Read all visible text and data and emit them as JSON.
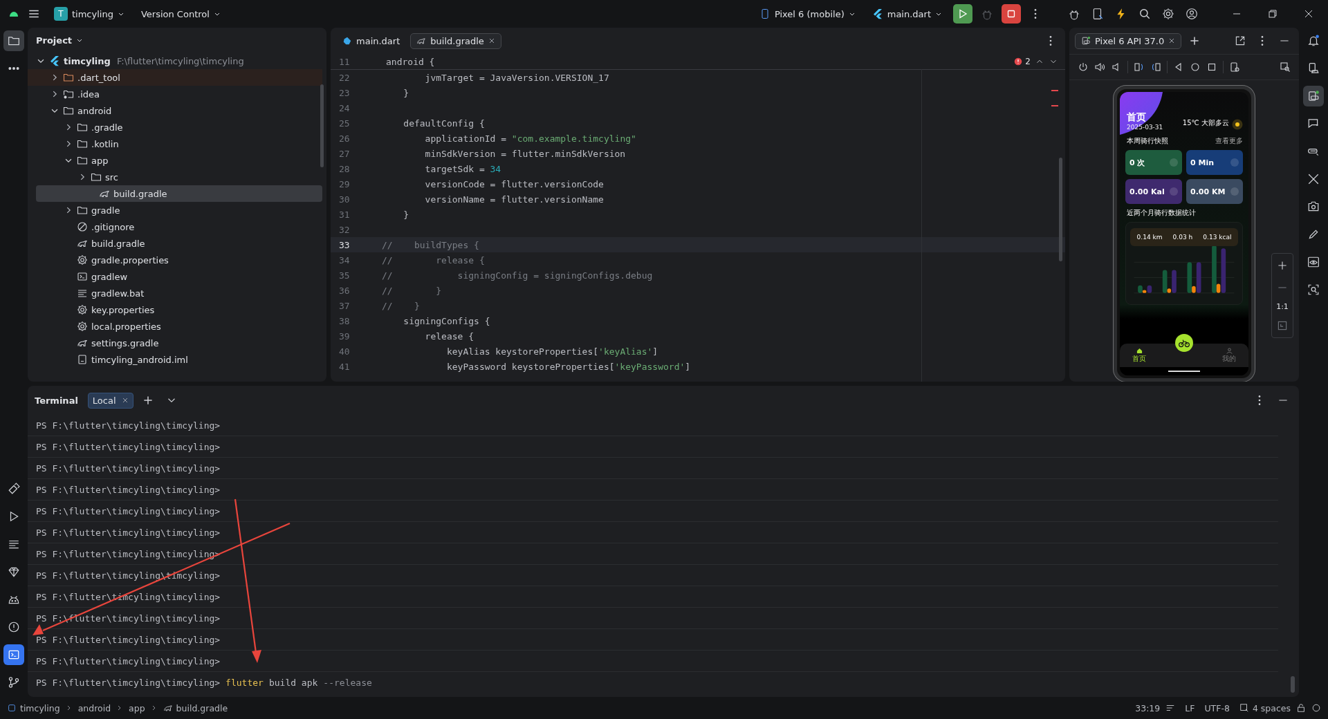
{
  "top_bar": {
    "project_badge": "T",
    "project": "timcyling",
    "vcs": "Version Control",
    "device": "Pixel 6 (mobile)",
    "run_config": "main.dart"
  },
  "left_tools": [
    {
      "kind": "folder",
      "selected": true
    },
    {
      "kind": "more",
      "selected": false
    }
  ],
  "left_tools_bottom": [
    {
      "kind": "brush",
      "selected": false
    },
    {
      "kind": "run",
      "selected": false
    },
    {
      "kind": "lines",
      "selected": false
    },
    {
      "kind": "gem",
      "selected": false
    },
    {
      "kind": "android",
      "selected": false
    },
    {
      "kind": "problems",
      "selected": false
    },
    {
      "kind": "terminal",
      "selected": true
    },
    {
      "kind": "git",
      "selected": false
    }
  ],
  "project": {
    "title": "Project",
    "tree": [
      {
        "label": "timcyling",
        "path": "F:\\flutter\\timcyling\\timcyling",
        "kind": "flutter",
        "expanded": true,
        "selected": false,
        "excluded": false,
        "children": [
          {
            "label": ".dart_tool",
            "kind": "folder",
            "expanded": false,
            "selected": false,
            "excluded": true
          },
          {
            "label": ".idea",
            "kind": "folder-config",
            "expanded": false,
            "selected": false,
            "excluded": false
          },
          {
            "label": "android",
            "kind": "folder",
            "expanded": true,
            "selected": false,
            "excluded": false,
            "children": [
              {
                "label": ".gradle",
                "kind": "folder",
                "expanded": false,
                "selected": false,
                "excluded": false
              },
              {
                "label": ".kotlin",
                "kind": "folder",
                "expanded": false,
                "selected": false,
                "excluded": false
              },
              {
                "label": "app",
                "kind": "folder",
                "expanded": true,
                "selected": false,
                "excluded": false,
                "children": [
                  {
                    "label": "src",
                    "kind": "folder",
                    "expanded": false,
                    "selected": false,
                    "excluded": false
                  },
                  {
                    "label": "build.gradle",
                    "kind": "gradle",
                    "selected": true,
                    "excluded": false
                  }
                ]
              },
              {
                "label": "gradle",
                "kind": "folder",
                "expanded": false,
                "selected": false,
                "excluded": false
              },
              {
                "label": ".gitignore",
                "kind": "ignore",
                "selected": false,
                "excluded": false
              },
              {
                "label": "build.gradle",
                "kind": "gradle",
                "selected": false,
                "excluded": false
              },
              {
                "label": "gradle.properties",
                "kind": "gear",
                "selected": false,
                "excluded": false
              },
              {
                "label": "gradlew",
                "kind": "terminal",
                "selected": false,
                "excluded": false
              },
              {
                "label": "gradlew.bat",
                "kind": "lines",
                "selected": false,
                "excluded": false
              },
              {
                "label": "key.properties",
                "kind": "gear",
                "selected": false,
                "excluded": false
              },
              {
                "label": "local.properties",
                "kind": "gear",
                "selected": false,
                "excluded": false
              },
              {
                "label": "settings.gradle",
                "kind": "gradle",
                "selected": false,
                "excluded": false
              },
              {
                "label": "timcyling_android.iml",
                "kind": "file",
                "selected": false,
                "excluded": false
              }
            ]
          }
        ]
      }
    ]
  },
  "editor": {
    "tabs": [
      {
        "label": "main.dart",
        "kind": "dart",
        "selected": false
      },
      {
        "label": "build.gradle",
        "kind": "gradle",
        "selected": true
      }
    ],
    "error_count": "2",
    "sticky": {
      "num": "11",
      "tokens": [
        {
          "kind": "plain",
          "text": "android {"
        }
      ]
    },
    "lines": [
      {
        "num": "22",
        "current": false,
        "tokens": [
          {
            "kind": "plain",
            "text": "        jvmTarget = JavaVersion.VERSION_17"
          }
        ]
      },
      {
        "num": "23",
        "current": false,
        "tokens": [
          {
            "kind": "plain",
            "text": "    }"
          }
        ]
      },
      {
        "num": "24",
        "current": false
      },
      {
        "num": "25",
        "current": false,
        "tokens": [
          {
            "kind": "plain",
            "text": "    defaultConfig {"
          }
        ]
      },
      {
        "num": "26",
        "current": false,
        "tokens": [
          {
            "kind": "plain",
            "text": "        applicationId = "
          },
          {
            "kind": "string",
            "text": "\"com.example.timcyling\""
          }
        ]
      },
      {
        "num": "27",
        "current": false,
        "tokens": [
          {
            "kind": "plain",
            "text": "        minSdkVersion = flutter.minSdkVersion"
          }
        ]
      },
      {
        "num": "28",
        "current": false,
        "tokens": [
          {
            "kind": "plain",
            "text": "        targetSdk = "
          },
          {
            "kind": "number",
            "text": "34"
          }
        ]
      },
      {
        "num": "29",
        "current": false,
        "tokens": [
          {
            "kind": "plain",
            "text": "        versionCode = flutter.versionCode"
          }
        ]
      },
      {
        "num": "30",
        "current": false,
        "tokens": [
          {
            "kind": "plain",
            "text": "        versionName = flutter.versionName"
          }
        ]
      },
      {
        "num": "31",
        "current": false,
        "tokens": [
          {
            "kind": "plain",
            "text": "    }"
          }
        ]
      },
      {
        "num": "32",
        "current": false
      },
      {
        "num": "33",
        "current": true,
        "tokens": [
          {
            "kind": "comment",
            "text": "//    buildTypes {"
          }
        ]
      },
      {
        "num": "34",
        "current": false,
        "tokens": [
          {
            "kind": "comment",
            "text": "//        release {"
          }
        ]
      },
      {
        "num": "35",
        "current": false,
        "tokens": [
          {
            "kind": "comment",
            "text": "//            signingConfig = signingConfigs.debug"
          }
        ]
      },
      {
        "num": "36",
        "current": false,
        "tokens": [
          {
            "kind": "comment",
            "text": "//        }"
          }
        ]
      },
      {
        "num": "37",
        "current": false,
        "tokens": [
          {
            "kind": "comment",
            "text": "//    }"
          }
        ]
      },
      {
        "num": "38",
        "current": false,
        "tokens": [
          {
            "kind": "plain",
            "text": "    signingConfigs {"
          }
        ]
      },
      {
        "num": "39",
        "current": false,
        "tokens": [
          {
            "kind": "plain",
            "text": "        release {"
          }
        ]
      },
      {
        "num": "40",
        "current": false,
        "tokens": [
          {
            "kind": "plain",
            "text": "            keyAlias keystoreProperties["
          },
          {
            "kind": "string",
            "text": "'keyAlias'"
          },
          {
            "kind": "plain",
            "text": "]"
          }
        ]
      },
      {
        "num": "41",
        "current": false,
        "tokens": [
          {
            "kind": "plain",
            "text": "            keyPassword keystoreProperties["
          },
          {
            "kind": "string",
            "text": "'keyPassword'"
          },
          {
            "kind": "plain",
            "text": "]"
          }
        ]
      }
    ]
  },
  "emulator": {
    "tab": "Pixel 6 API 37.0",
    "zoom_reset": "1:1",
    "phone": {
      "title": "首页",
      "date": "2025-03-31",
      "weather": "15℃ 大部多云",
      "section": "本周骑行快照",
      "more": "查看更多",
      "cards": [
        {
          "value": "0 次",
          "color": "#1e5c3e"
        },
        {
          "value": "0 Min",
          "color": "#173d78"
        },
        {
          "value": "0.00 Kal",
          "color": "#3f2a6e"
        },
        {
          "value": "0.00 KM",
          "color": "#3a4a60"
        }
      ],
      "stats_title": "近两个月骑行数据统计",
      "stats": [
        "0.14 km",
        "0.03 h",
        "0.13 kcal"
      ],
      "nav": [
        {
          "label": "首页",
          "selected": true
        },
        {
          "label": "我的",
          "selected": false
        }
      ]
    }
  },
  "right_tools": [
    {
      "kind": "bell",
      "selected": false
    },
    {
      "kind": "device",
      "selected": false
    },
    {
      "kind": "running",
      "selected": true
    },
    {
      "kind": "mirror",
      "selected": false
    },
    {
      "kind": "link",
      "selected": false
    },
    {
      "kind": "tools",
      "selected": false
    },
    {
      "kind": "inspect",
      "selected": false
    },
    {
      "kind": "pencil",
      "selected": false
    },
    {
      "kind": "eye",
      "selected": false
    },
    {
      "kind": "zoom",
      "selected": false
    }
  ],
  "terminal": {
    "title": "Terminal",
    "tabs": [
      {
        "label": "Local",
        "selected": true
      }
    ],
    "lines": [
      {
        "prompt": "PS F:\\flutter\\timcyling\\timcyling>",
        "current": false
      },
      {
        "prompt": "PS F:\\flutter\\timcyling\\timcyling>",
        "current": false
      },
      {
        "prompt": "PS F:\\flutter\\timcyling\\timcyling>",
        "current": false
      },
      {
        "prompt": "PS F:\\flutter\\timcyling\\timcyling>",
        "current": false
      },
      {
        "prompt": "PS F:\\flutter\\timcyling\\timcyling>",
        "current": false
      },
      {
        "prompt": "PS F:\\flutter\\timcyling\\timcyling>",
        "current": false
      },
      {
        "prompt": "PS F:\\flutter\\timcyling\\timcyling>",
        "current": false
      },
      {
        "prompt": "PS F:\\flutter\\timcyling\\timcyling>",
        "current": false
      },
      {
        "prompt": "PS F:\\flutter\\timcyling\\timcyling>",
        "current": false
      },
      {
        "prompt": "PS F:\\flutter\\timcyling\\timcyling>",
        "current": false
      },
      {
        "prompt": "PS F:\\flutter\\timcyling\\timcyling>",
        "current": false
      },
      {
        "prompt": "PS F:\\flutter\\timcyling\\timcyling>",
        "current": false
      },
      {
        "prompt": "PS F:\\flutter\\timcyling\\timcyling>",
        "current": true,
        "command": "flutter",
        "args": "build apk",
        "option": "--release"
      }
    ]
  },
  "status_bar": {
    "breadcrumbs": [
      {
        "label": "timcyling",
        "kind": "module"
      },
      {
        "label": "android",
        "kind": "plain"
      },
      {
        "label": "app",
        "kind": "plain"
      },
      {
        "label": "build.gradle",
        "kind": "gradle"
      }
    ],
    "position": "33:19",
    "line_sep": "LF",
    "encoding": "UTF-8",
    "indent": "4 spaces"
  }
}
